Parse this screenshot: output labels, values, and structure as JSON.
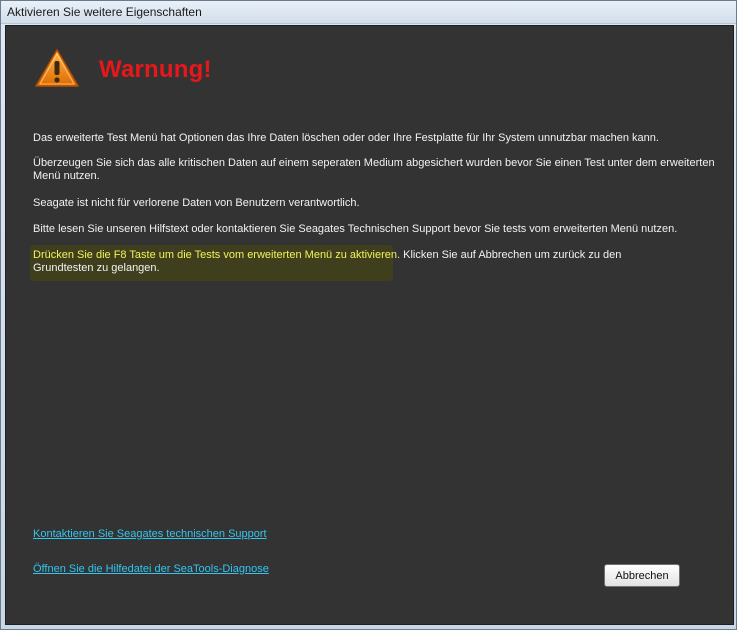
{
  "window": {
    "title": "Aktivieren Sie weitere Eigenschaften"
  },
  "warning": {
    "icon": "warning-triangle-icon",
    "title": "Warnung!",
    "title_color": "#e8171a"
  },
  "paragraphs": {
    "p1": "Das erweiterte Test Menü hat Optionen das Ihre Daten löschen oder oder Ihre Festplatte für Ihr System  unnutzbar machen kann.",
    "p2": "Überzeugen Sie sich das alle kritischen Daten auf einem seperaten Medium abgesichert wurden bevor Sie einen Test unter dem erweiterten Menü nutzen.",
    "p3": "Seagate ist nicht für verlorene Daten von Benutzern verantwortlich.",
    "p4": "Bitte lesen Sie unseren Hilfstext oder kontaktieren Sie Seagates Technischen Support bevor Sie tests vom erweiterten Menü nutzen.",
    "p5_highlight": "Drücken Sie die F8 Taste um die Tests vom erweiterten Menü zu aktivieren.",
    "p5_rest": " Klicken Sie auf Abbrechen um zurück zu den Grundtesten zu gelangen."
  },
  "colors": {
    "background": "#333333",
    "text": "#f2f2f2",
    "highlight_text": "#f4f25a",
    "link": "#34c5ef"
  },
  "links": {
    "support": "Kontaktieren Sie Seagates technischen Support",
    "helpfile": "Öffnen Sie die Hilfedatei der SeaTools-Diagnose"
  },
  "buttons": {
    "cancel": "Abbrechen"
  }
}
